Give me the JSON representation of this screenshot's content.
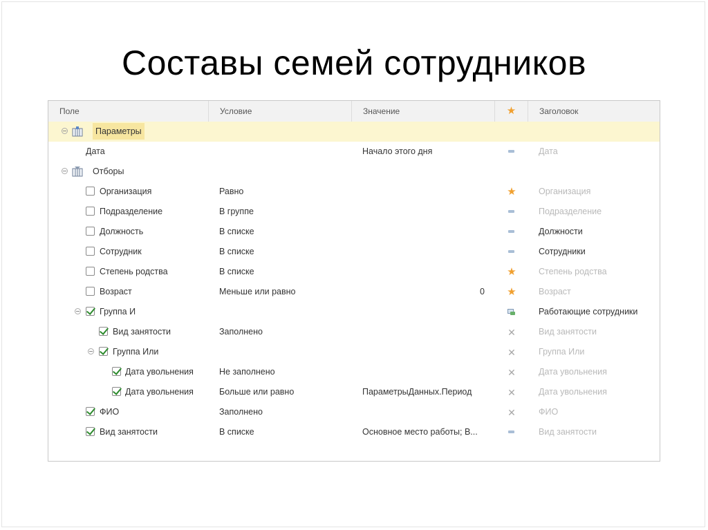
{
  "slide": {
    "title": "Составы семей сотрудников"
  },
  "grid": {
    "columns": {
      "field": "Поле",
      "condition": "Условие",
      "value": "Значение",
      "usage": "★",
      "heading": "Заголовок"
    },
    "rows": [
      {
        "field": "Параметры",
        "condition": "",
        "value": "",
        "indicator": "none",
        "heading": "",
        "icon": "parameters-icon",
        "selected": true
      },
      {
        "field": "Дата",
        "condition": "",
        "value": "Начало этого дня",
        "indicator": "dash-icon",
        "heading": "Дата",
        "heading_muted": true
      },
      {
        "field": "Отборы",
        "condition": "",
        "value": "",
        "indicator": "none",
        "heading": "",
        "icon": "filters-icon"
      },
      {
        "field": "Организация",
        "condition": "Равно",
        "value": "",
        "indicator": "star-icon",
        "heading": "Организация",
        "checked": false,
        "heading_muted": true
      },
      {
        "field": "Подразделение",
        "condition": "В группе",
        "value": "",
        "indicator": "dash-icon",
        "heading": "Подразделение",
        "checked": false,
        "heading_muted": true
      },
      {
        "field": "Должность",
        "condition": "В списке",
        "value": "",
        "indicator": "dash-icon",
        "heading": "Должности",
        "checked": false,
        "heading_muted": false
      },
      {
        "field": "Сотрудник",
        "condition": "В списке",
        "value": "",
        "indicator": "dash-icon",
        "heading": "Сотрудники",
        "checked": false,
        "heading_muted": false
      },
      {
        "field": "Степень родства",
        "condition": "В списке",
        "value": "",
        "indicator": "star-icon",
        "heading": "Степень родства",
        "checked": false,
        "heading_muted": true
      },
      {
        "field": "Возраст",
        "condition": "Меньше или равно",
        "value": "0",
        "indicator": "star-icon",
        "heading": "Возраст",
        "checked": false,
        "heading_muted": true
      },
      {
        "field": "Группа И",
        "condition": "",
        "value": "",
        "indicator": "group-icon",
        "heading": "Работающие сотрудники",
        "checked": true,
        "heading_muted": false
      },
      {
        "field": "Вид занятости",
        "condition": "Заполнено",
        "value": "",
        "indicator": "x-icon",
        "heading": "Вид занятости",
        "checked": true,
        "heading_muted": true
      },
      {
        "field": "Группа Или",
        "condition": "",
        "value": "",
        "indicator": "x-icon",
        "heading": "Группа Или",
        "checked": true,
        "heading_muted": true
      },
      {
        "field": "Дата увольнения",
        "condition": "Не заполнено",
        "value": "",
        "indicator": "x-icon",
        "heading": "Дата увольнения",
        "checked": true,
        "heading_muted": true
      },
      {
        "field": "Дата увольнения",
        "condition": "Больше или равно",
        "value": "ПараметрыДанных.Период",
        "indicator": "x-icon",
        "heading": "Дата увольнения",
        "checked": true,
        "heading_muted": true
      },
      {
        "field": "ФИО",
        "condition": "Заполнено",
        "value": "",
        "indicator": "x-icon",
        "heading": "ФИО",
        "checked": true,
        "heading_muted": true
      },
      {
        "field": "Вид занятости",
        "condition": "В списке",
        "value": "Основное место работы; В...",
        "indicator": "dash-icon",
        "heading": "Вид занятости",
        "checked": true,
        "heading_muted": true
      }
    ]
  }
}
